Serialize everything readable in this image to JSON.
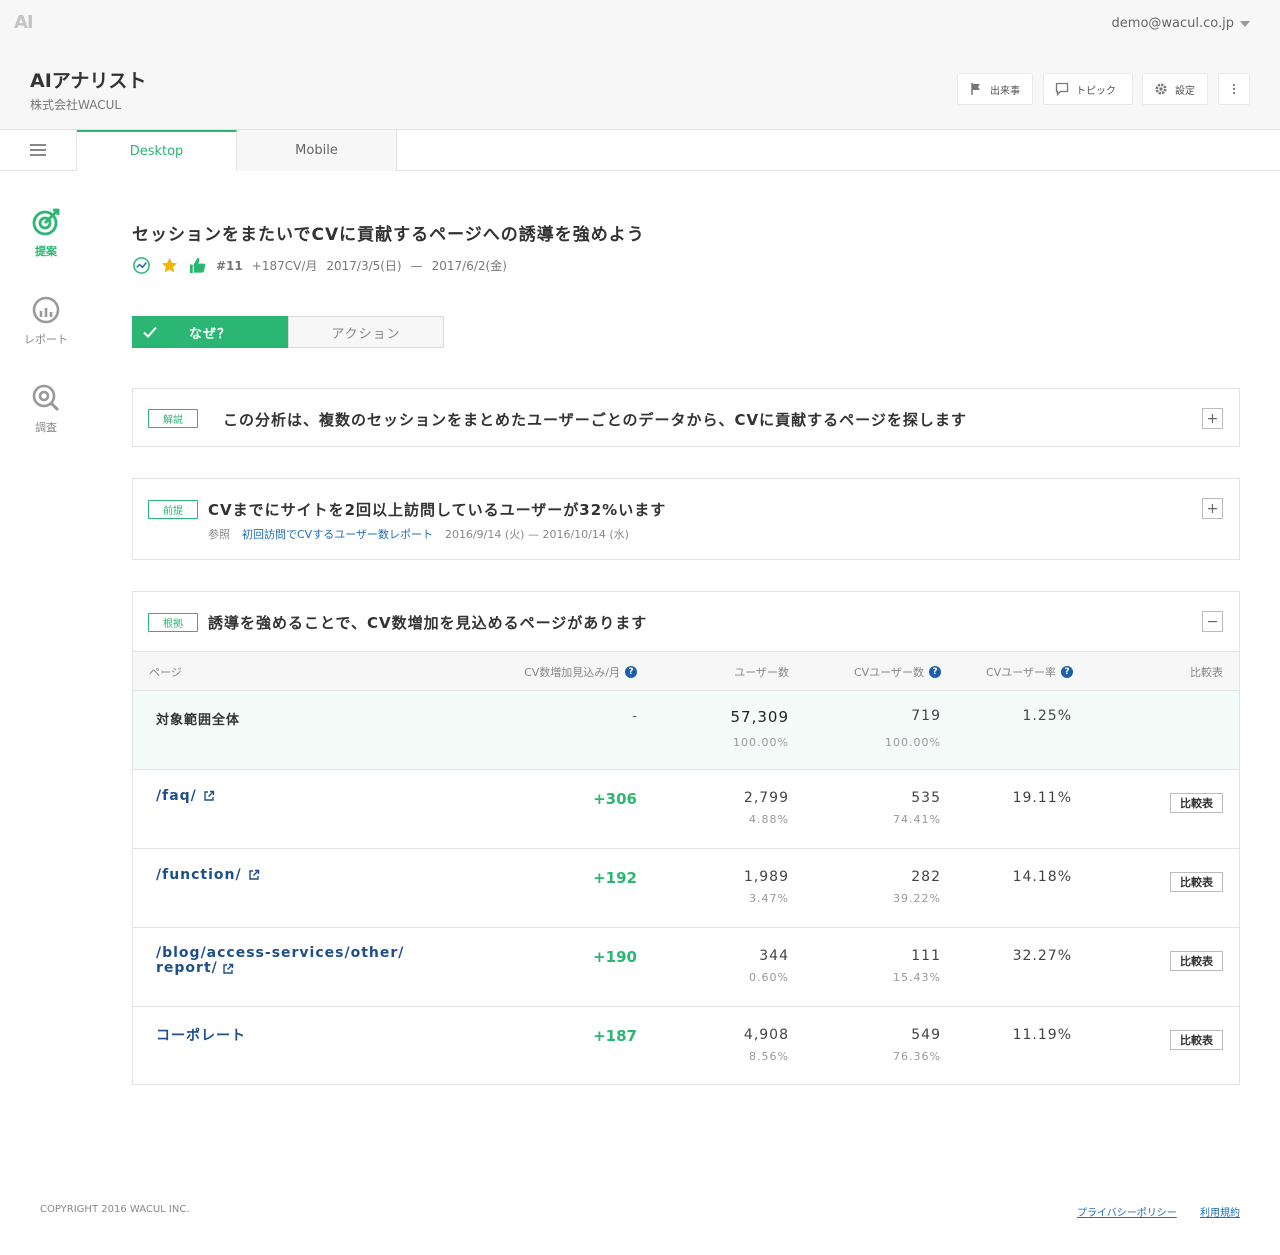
{
  "header": {
    "logo": "AI",
    "user_email": "demo@wacul.co.jp",
    "app_title": "AIアナリスト",
    "company": "株式会社WACUL",
    "buttons": {
      "events": "出来事",
      "topics": "トピック",
      "settings": "設定"
    }
  },
  "tabs": [
    {
      "label": "Desktop",
      "active": true
    },
    {
      "label": "Mobile",
      "active": false
    }
  ],
  "sidebar": [
    {
      "label": "提案",
      "icon": "target-icon",
      "active": true
    },
    {
      "label": "レポート",
      "icon": "report-gauge-icon",
      "active": false
    },
    {
      "label": "調査",
      "icon": "search-analysis-icon",
      "active": false
    }
  ],
  "proposal": {
    "title": "セッションをまたいでCVに貢献するページへの誘導を強めよう",
    "number": "#11",
    "impact": "+187CV/月",
    "start_date": "2017/3/5(日)",
    "separator": "—",
    "end_date": "2017/6/2(金)"
  },
  "segment": {
    "why": "なぜ？",
    "action": "アクション"
  },
  "cards": {
    "explanation": {
      "badge": "解説",
      "title": "この分析は、複数のセッションをまとめたユーザーごとのデータから、CVに貢献するページを探します",
      "toggle": "+"
    },
    "premise": {
      "badge": "前提",
      "title": "CVまでにサイトを2回以上訪問しているユーザーが32%います",
      "toggle": "+",
      "ref_label": "参照",
      "ref_link": "初回訪問でCVするユーザー数レポート",
      "ref_period": "2016/9/14 (火)  —  2016/10/14 (水)"
    },
    "evidence": {
      "badge": "根拠",
      "title": "誘導を強めることで、CV数増加を見込めるページがあります",
      "toggle": "−"
    }
  },
  "table": {
    "headers": {
      "page": "ページ",
      "cv_increase": "CV数増加見込み/月",
      "users": "ユーザー数",
      "cv_users": "CVユーザー数",
      "cv_rate": "CVユーザー率",
      "compare": "比較表"
    },
    "help_glyph": "?",
    "total": {
      "page": "対象範囲全体",
      "cv_increase": "-",
      "users": "57,309",
      "users_pct": "100.00%",
      "cv_users": "719",
      "cv_users_pct": "100.00%",
      "cv_rate": "1.25%"
    },
    "rows": [
      {
        "page": "/faq/",
        "cv_increase": "+306",
        "users": "2,799",
        "users_pct": "4.88%",
        "cv_users": "535",
        "cv_users_pct": "74.41%",
        "cv_rate": "19.11%",
        "compare": "比較表"
      },
      {
        "page": "/function/",
        "cv_increase": "+192",
        "users": "1,989",
        "users_pct": "3.47%",
        "cv_users": "282",
        "cv_users_pct": "39.22%",
        "cv_rate": "14.18%",
        "compare": "比較表"
      },
      {
        "page_line1": "/blog/access-services/other/",
        "page_line2": "report/",
        "cv_increase": "+190",
        "users": "344",
        "users_pct": "0.60%",
        "cv_users": "111",
        "cv_users_pct": "15.43%",
        "cv_rate": "32.27%",
        "compare": "比較表"
      },
      {
        "page": "コーポレート",
        "cv_increase": "+187",
        "users": "4,908",
        "users_pct": "8.56%",
        "cv_users": "549",
        "cv_users_pct": "76.36%",
        "cv_rate": "11.19%",
        "compare": "比較表"
      }
    ]
  },
  "footer": {
    "copyright": "COPYRIGHT 2016 WACUL INC.",
    "privacy": "プライバシーポリシー",
    "terms": "利用規約"
  },
  "colors": {
    "accent": "#2bb673",
    "link": "#1e4f8a",
    "star": "#f5b400"
  }
}
